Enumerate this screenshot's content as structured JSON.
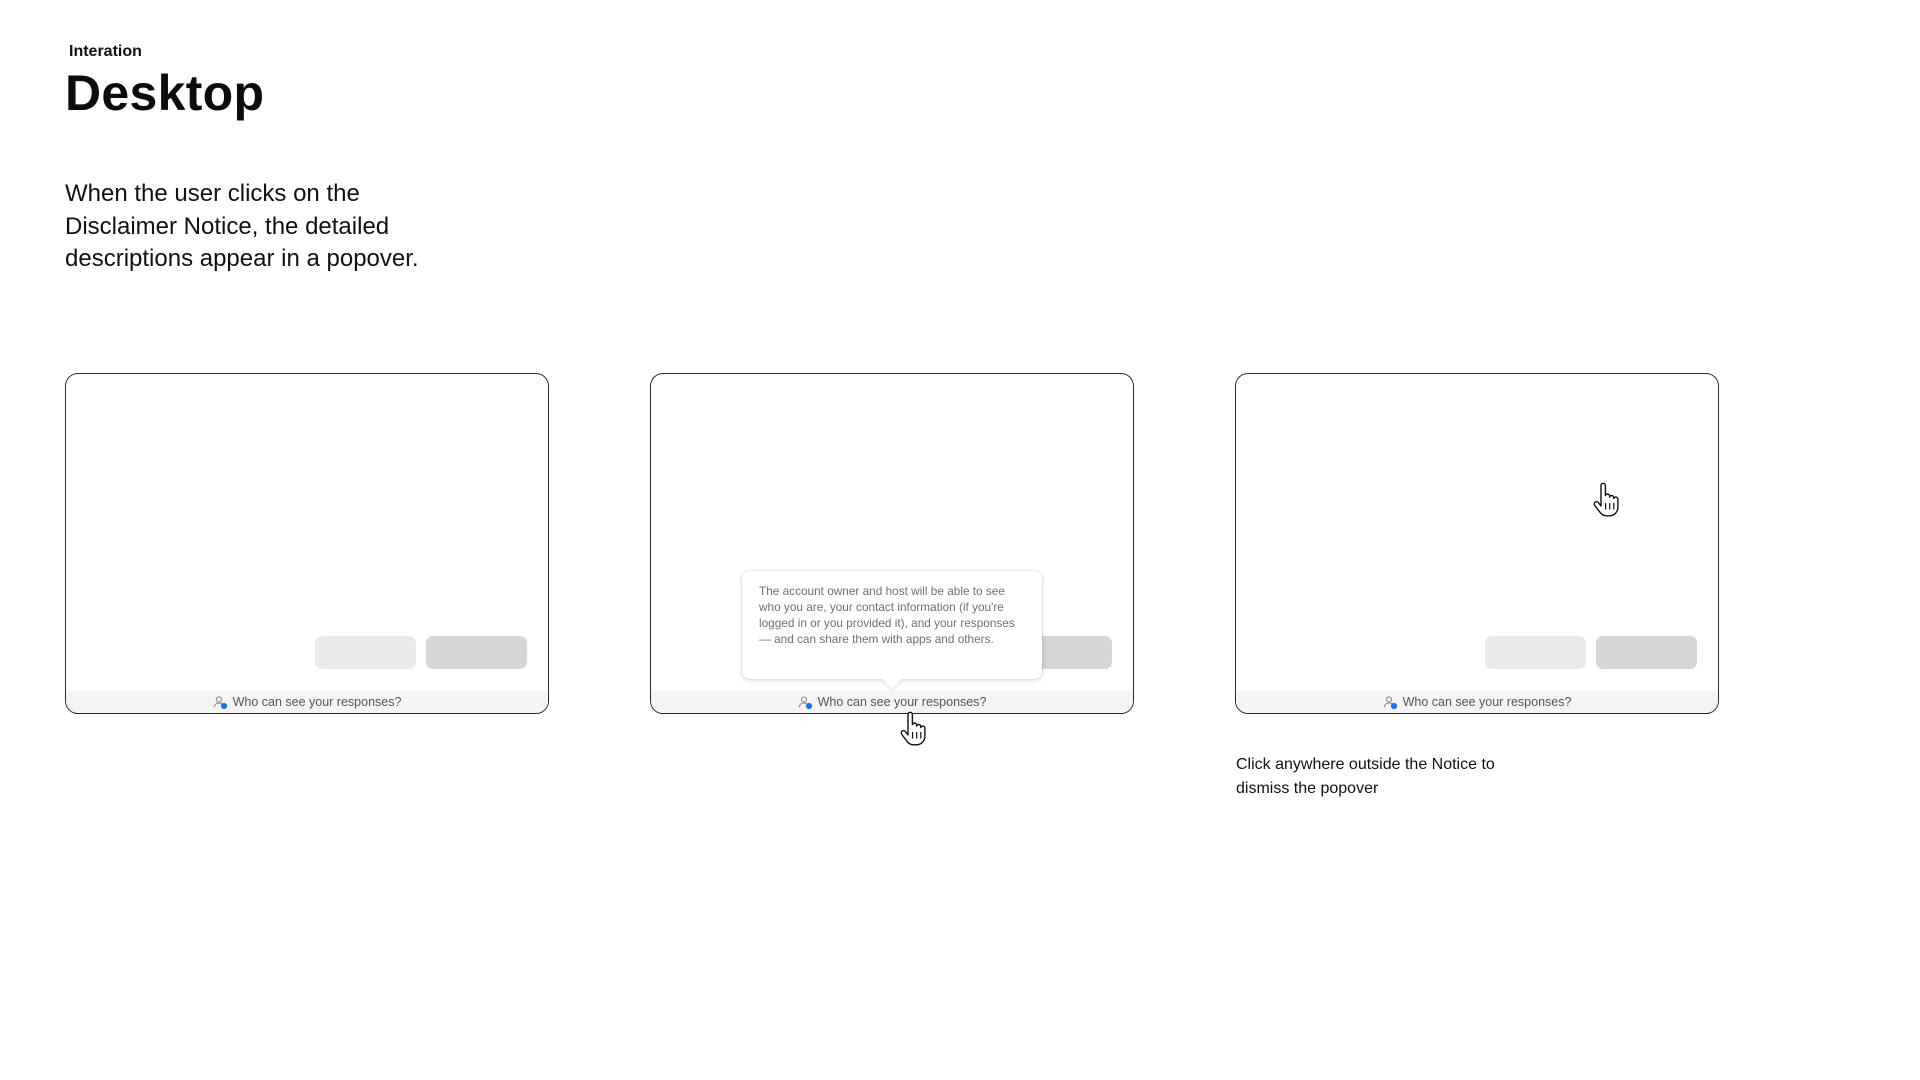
{
  "header": {
    "eyebrow": "Interation",
    "title": "Desktop"
  },
  "description": "When the user clicks on the Disclaimer Notice, the detailed descriptions appear in a popover.",
  "frames": [
    {
      "notice_text": "Who can see your responses?"
    },
    {
      "notice_text": "Who can see your responses?"
    },
    {
      "notice_text": "Who can see your responses?"
    }
  ],
  "popover": {
    "text": "The account owner and host will be able to see who you are, your contact information (if you're logged in or you provided it), and your responses — and can share them with apps and others."
  },
  "hint": "Click anywhere outside the Notice to dismiss the popover",
  "icons": {
    "notice": "person-icon",
    "cursor": "hand-pointer-icon"
  },
  "colors": {
    "accent": "#1a73e8",
    "button_secondary": "#e9e9e9",
    "button_primary": "#d6d6d6",
    "notice_bar": "#f4f4f6"
  }
}
